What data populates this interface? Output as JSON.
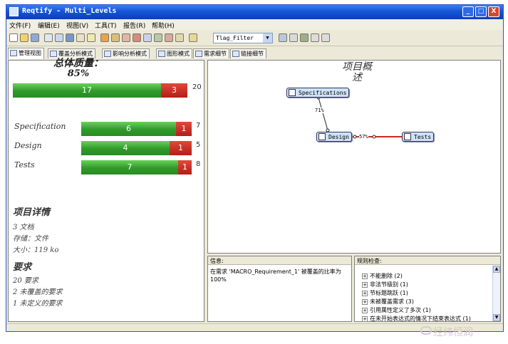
{
  "window": {
    "title": "Reqtify - Multi_Levels",
    "controls": [
      "_",
      "□",
      "X"
    ]
  },
  "menu": [
    "文件(F)",
    "编辑(E)",
    "视图(V)",
    "工具(T)",
    "报告(R)",
    "帮助(H)"
  ],
  "toolbar": {
    "filter_value": "Tlag_Filter"
  },
  "tabs": [
    "管理视图",
    "覆盖分析模式",
    "影响分析模式",
    "图形模式",
    "需求细节",
    "链接细节"
  ],
  "left": {
    "quality_title": "总体质量：",
    "quality_pct": "85%",
    "overall": {
      "covered": 17,
      "uncovered": 3,
      "total": 20
    },
    "categories": [
      {
        "name": "Specification",
        "covered": 6,
        "uncovered": 1,
        "total": 7
      },
      {
        "name": "Design",
        "covered": 4,
        "uncovered": 1,
        "total": 5
      },
      {
        "name": "Tests",
        "covered": 7,
        "uncovered": 1,
        "total": 8
      }
    ],
    "details_head": "项目详情",
    "details": [
      "3 文档",
      "存储：文件",
      "大小：119 ko"
    ],
    "req_head": "要求",
    "reqs": [
      "20 要求",
      "2 未覆盖的要求",
      "1 未定义的要求"
    ]
  },
  "graph": {
    "title_line1": "项目概",
    "title_line2": "述",
    "nodes": {
      "spec": "Specifications",
      "design": "Design",
      "tests": "Tests"
    },
    "edges": {
      "spec_design": "71%",
      "design_tests": "57%"
    }
  },
  "info": {
    "header": "信息:",
    "text": "在需求 'MACRO_Requirement_1' 被覆盖的比率为 100%"
  },
  "checks": {
    "header": "规则检查:",
    "items": [
      "不能删除 (2)",
      "非法节级别 (1)",
      "节标题跳跃 (1)",
      "未被覆盖需求 (3)",
      "引用属性定义了多次 (1)",
      "在未开始表达式的情况下结束表达式 (1)"
    ]
  },
  "watermark": "经纬恒润",
  "colors": {
    "green": "#2f9a2a",
    "red": "#b31d17",
    "node_fill": "#cfe2f6",
    "edge_red": "#cc2a1e"
  }
}
